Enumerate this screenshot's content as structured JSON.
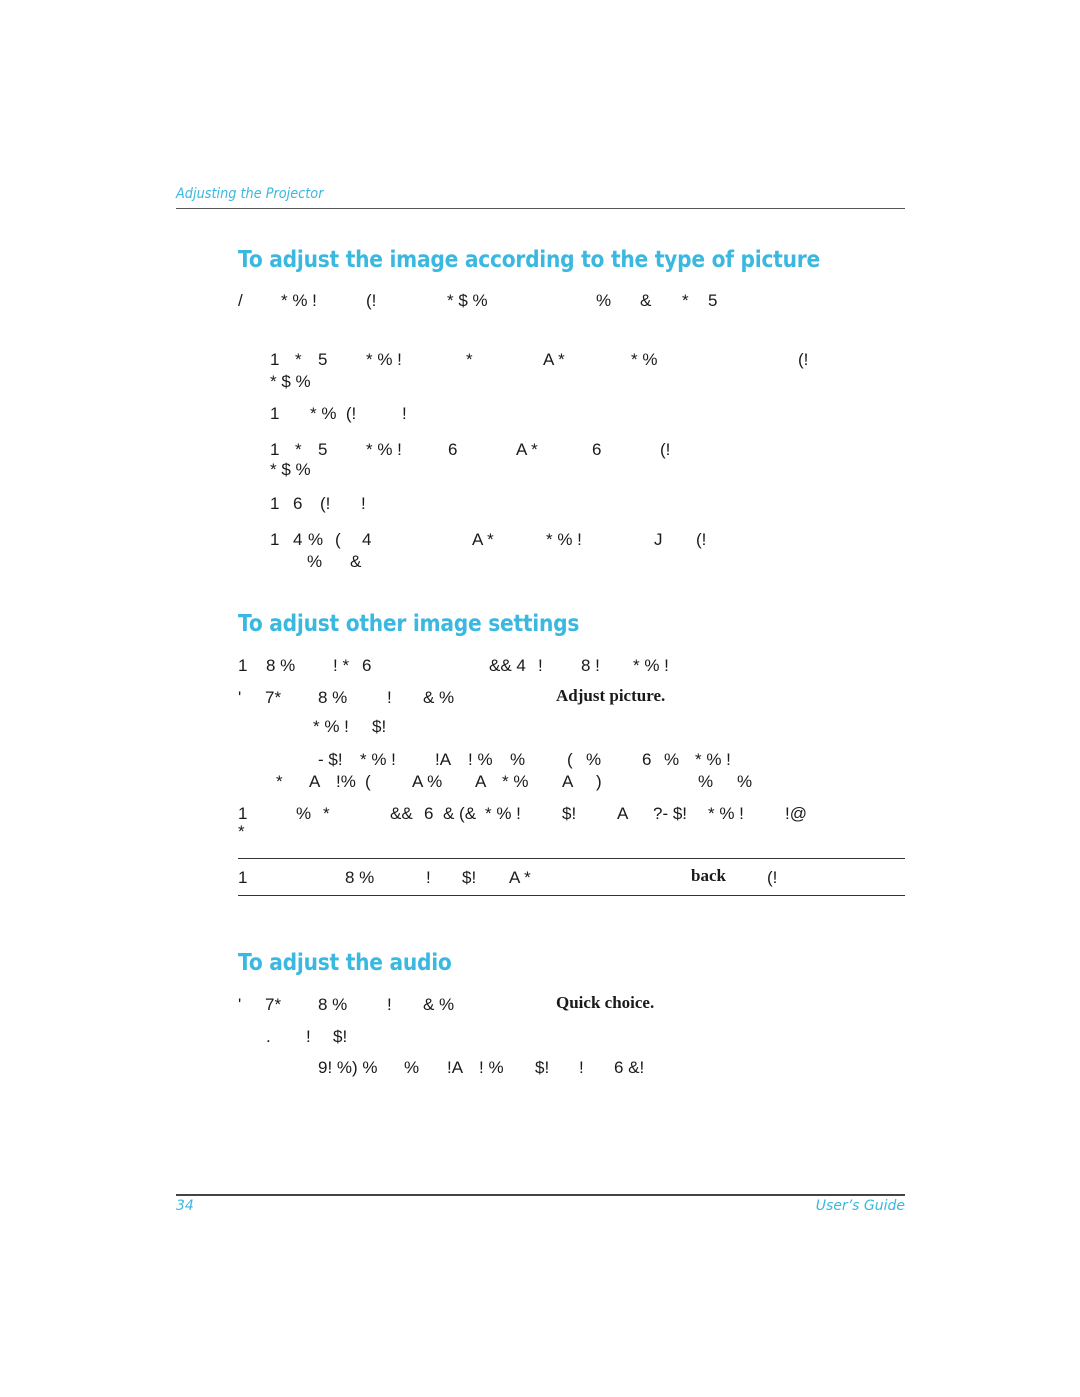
{
  "header": {
    "section_title": "Adjusting the Projector"
  },
  "sections": [
    {
      "heading": "To adjust the image according to the type of picture"
    },
    {
      "heading": "To adjust other image settings"
    },
    {
      "heading": "To adjust the audio"
    }
  ],
  "sec1": {
    "intro": [
      "/",
      "* % !",
      "(!",
      "* $ %",
      "%",
      "&",
      "*",
      "5"
    ],
    "l1": [
      "1",
      "*",
      "5",
      "* % !",
      "*",
      "A *",
      "* %",
      "(!"
    ],
    "l1b": [
      "* $ %"
    ],
    "l2": [
      "1",
      "* %  (!",
      "!"
    ],
    "l3": [
      "1",
      "*",
      "5",
      "* % !",
      "6",
      "A *",
      "6",
      "(!"
    ],
    "l3b": [
      "* $ %"
    ],
    "l4": [
      "1",
      "6",
      "(!",
      "!"
    ],
    "l5": [
      "1",
      "4",
      "%",
      "(",
      "4",
      "A *",
      "* % !",
      "J",
      "(!"
    ],
    "l5b": [
      "%",
      "&"
    ]
  },
  "sec2": {
    "l1": [
      "1",
      "8 %",
      "! *",
      "6",
      "&& 4",
      "!",
      "8 !",
      "* % !"
    ],
    "l2": [
      "'",
      "7*",
      "8 %",
      "!",
      "& %"
    ],
    "l2_bold": "Adjust picture.",
    "l3": [
      "* % !",
      "$!"
    ],
    "l4": [
      "- $!",
      "* % !",
      "!A",
      "! %",
      "%",
      "(",
      "%",
      "6",
      "%",
      "* % !"
    ],
    "l5": [
      "*",
      "A",
      "!%",
      "(",
      "A %",
      "A",
      "* %",
      "A",
      ")",
      "%",
      "%"
    ],
    "l6": [
      "1",
      "%",
      "*",
      "&&",
      "6",
      "& (&",
      "* % !",
      "$!",
      "A",
      "?- $!",
      "* % !",
      "!@"
    ],
    "l6b": [
      "*"
    ],
    "note": [
      "1",
      "8 %",
      "!",
      "$!",
      "A *"
    ],
    "note_bold": "back",
    "note_end": "(!"
  },
  "sec3": {
    "l1": [
      "'",
      "7*",
      "8 %",
      "!",
      "& %"
    ],
    "l1_bold": "Quick choice.",
    "l2": [
      ".",
      "!",
      "$!"
    ],
    "l3": [
      "9! %) %",
      "%",
      "!A",
      "! %",
      "$!",
      "!",
      "6 &!"
    ]
  },
  "footer": {
    "page_number": "34",
    "guide_title": "User’s Guide"
  },
  "colors": {
    "accent": "#3bb8e0",
    "text": "#1a1a1a"
  }
}
